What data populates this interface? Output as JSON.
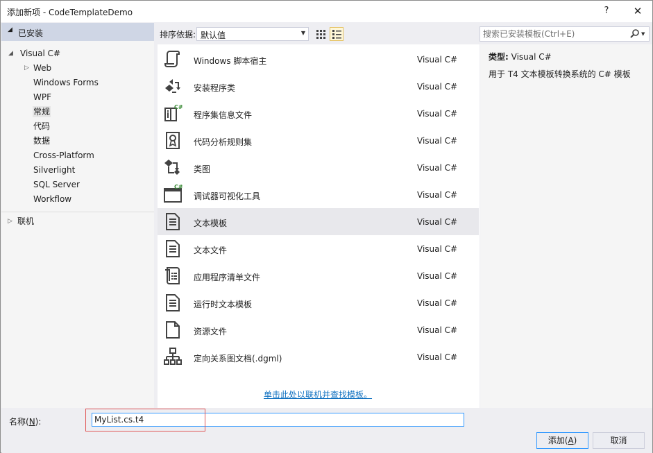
{
  "window": {
    "title": "添加新项 - CodeTemplateDemo",
    "help_btn": "?",
    "close_btn": "✕"
  },
  "left": {
    "header": "已安装",
    "tree": [
      {
        "label": "Visual C#",
        "arrow": "◢"
      },
      {
        "label": "Web",
        "arrow": "▷"
      },
      {
        "label": "Windows Forms"
      },
      {
        "label": "WPF"
      },
      {
        "label": "常规",
        "selected": true
      },
      {
        "label": "代码"
      },
      {
        "label": "数据"
      },
      {
        "label": "Cross-Platform"
      },
      {
        "label": "Silverlight"
      },
      {
        "label": "SQL Server"
      },
      {
        "label": "Workflow"
      }
    ],
    "online": {
      "label": "联机",
      "arrow": "▷"
    }
  },
  "sortbar": {
    "label": "排序依据:",
    "selected": "默认值"
  },
  "templates": [
    {
      "name": "Windows 脚本宿主",
      "lang": "Visual C#",
      "icon": "script-host-icon"
    },
    {
      "name": "安装程序类",
      "lang": "Visual C#",
      "icon": "installer-class-icon"
    },
    {
      "name": "程序集信息文件",
      "lang": "Visual C#",
      "icon": "assembly-info-icon"
    },
    {
      "name": "代码分析规则集",
      "lang": "Visual C#",
      "icon": "ruleset-icon"
    },
    {
      "name": "类图",
      "lang": "Visual C#",
      "icon": "class-diagram-icon"
    },
    {
      "name": "调试器可视化工具",
      "lang": "Visual C#",
      "icon": "debugger-visualizer-icon"
    },
    {
      "name": "文本模板",
      "lang": "Visual C#",
      "icon": "text-template-icon",
      "selected": true
    },
    {
      "name": "文本文件",
      "lang": "Visual C#",
      "icon": "text-file-icon"
    },
    {
      "name": "应用程序清单文件",
      "lang": "Visual C#",
      "icon": "manifest-icon"
    },
    {
      "name": "运行时文本模板",
      "lang": "Visual C#",
      "icon": "runtime-template-icon"
    },
    {
      "name": "资源文件",
      "lang": "Visual C#",
      "icon": "resource-file-icon"
    },
    {
      "name": "定向关系图文档(.dgml)",
      "lang": "Visual C#",
      "icon": "dgml-icon"
    }
  ],
  "online_link": "单击此处以联机并查找模板。",
  "search": {
    "placeholder": "搜索已安装模板(Ctrl+E)"
  },
  "details": {
    "type_label": "类型:",
    "type_value": "Visual C#",
    "description": "用于 T4 文本模板转换系统的 C# 模板"
  },
  "bottom": {
    "name_label_prefix": "名称(",
    "name_label_key": "N",
    "name_label_suffix": "):",
    "name_value": "MyList.cs.t4",
    "add_prefix": "添加(",
    "add_key": "A",
    "add_suffix": ")",
    "cancel": "取消"
  },
  "colors": {
    "accent": "#3399ff",
    "link": "#0e70c0",
    "highlight_box": "#e05555",
    "header_bg": "#cfd6e5"
  }
}
